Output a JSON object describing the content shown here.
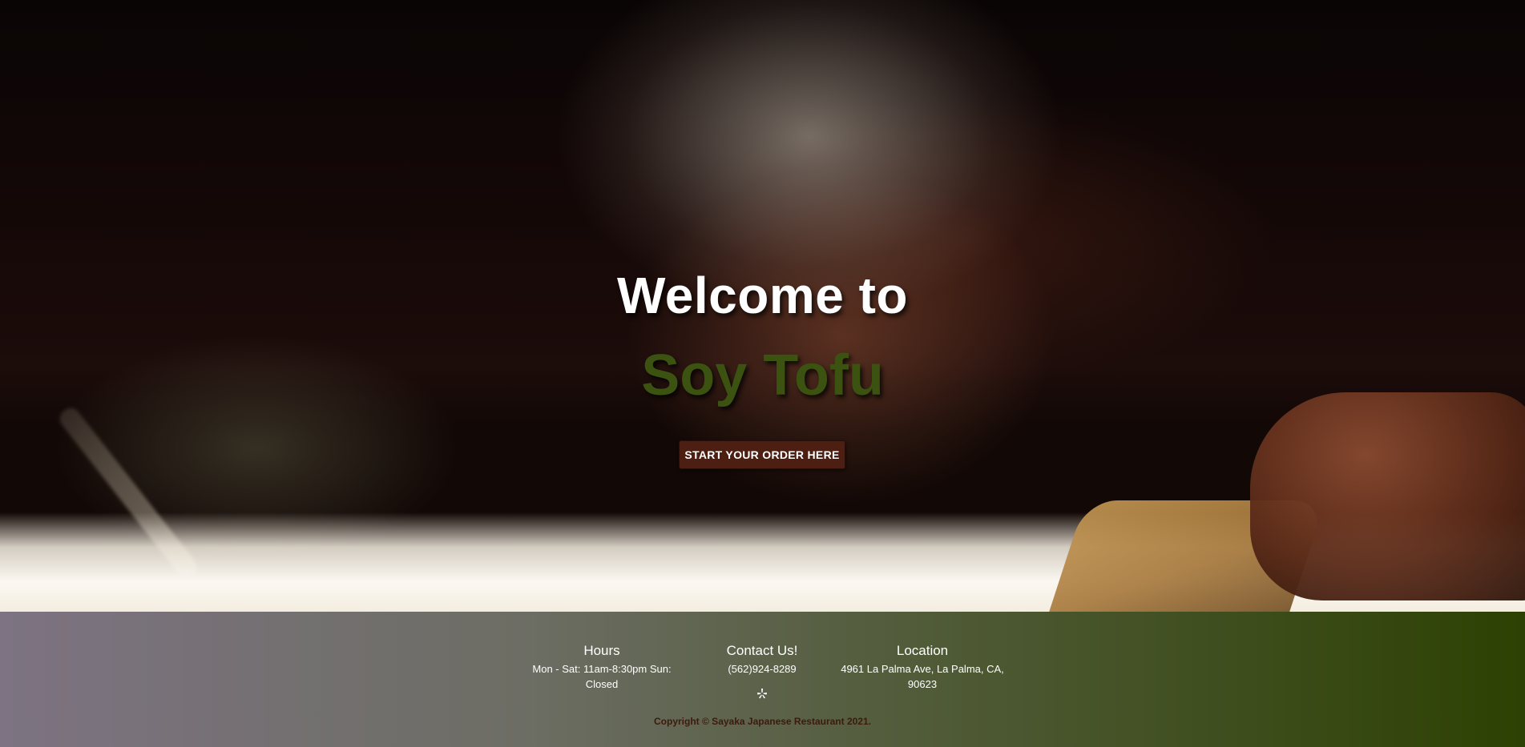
{
  "hero": {
    "welcome_text": "Welcome to",
    "brand_name": "Soy Tofu",
    "order_button_label": "START YOUR ORDER HERE"
  },
  "footer": {
    "hours": {
      "title": "Hours",
      "text": "Mon - Sat: 11am-8:30pm Sun: Closed"
    },
    "contact": {
      "title": "Contact Us!",
      "phone": "(562)924-8289",
      "social_icon": "yelp-icon"
    },
    "location": {
      "title": "Location",
      "address": "4961 La Palma Ave, La Palma, CA, 90623"
    },
    "copyright": "Copyright © Sayaka Japanese Restaurant 2021."
  },
  "colors": {
    "brand_green": "#3b5211",
    "button_brown": "#4d1e12",
    "copyright_brown": "#3d1a0d",
    "footer_gradient_start": "#7d7382",
    "footer_gradient_end": "#2d4103"
  }
}
